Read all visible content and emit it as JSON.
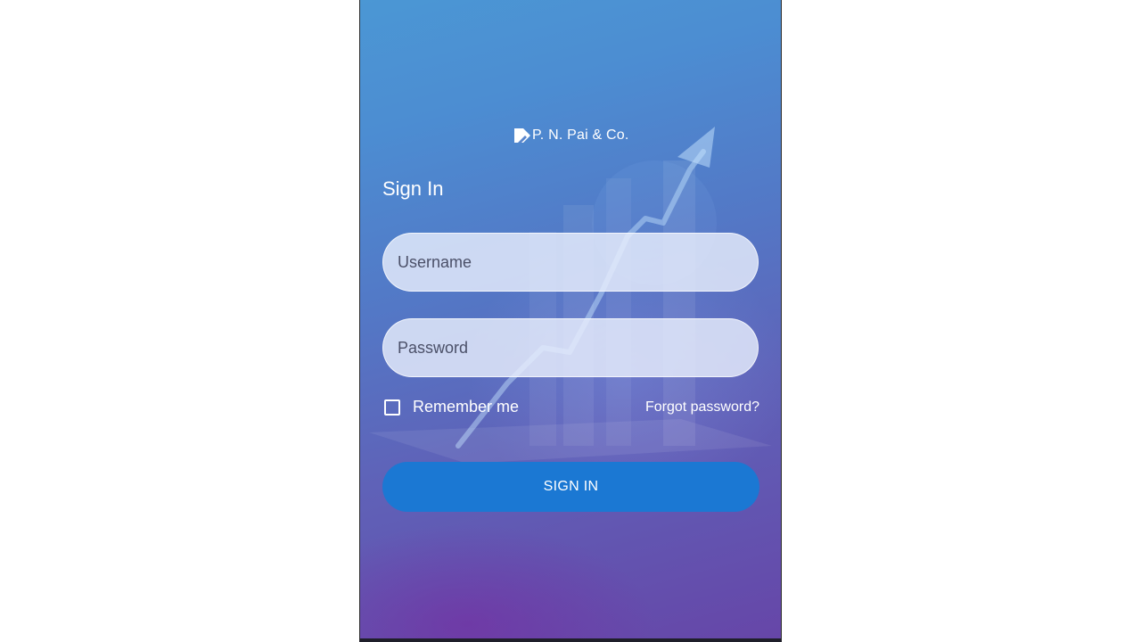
{
  "brand": {
    "name": "P. N. Pai & Co.",
    "logo_icon": "pn-pai-logo-icon"
  },
  "form": {
    "title": "Sign In",
    "username_placeholder": "Username",
    "password_placeholder": "Password",
    "remember_label": "Remember me",
    "remember_checked": false,
    "forgot_label": "Forgot password?",
    "submit_label": "SIGN IN"
  },
  "colors": {
    "button": "#1b78d3",
    "gradient_top": "#4b97d4",
    "gradient_bottom": "#6646a8"
  }
}
